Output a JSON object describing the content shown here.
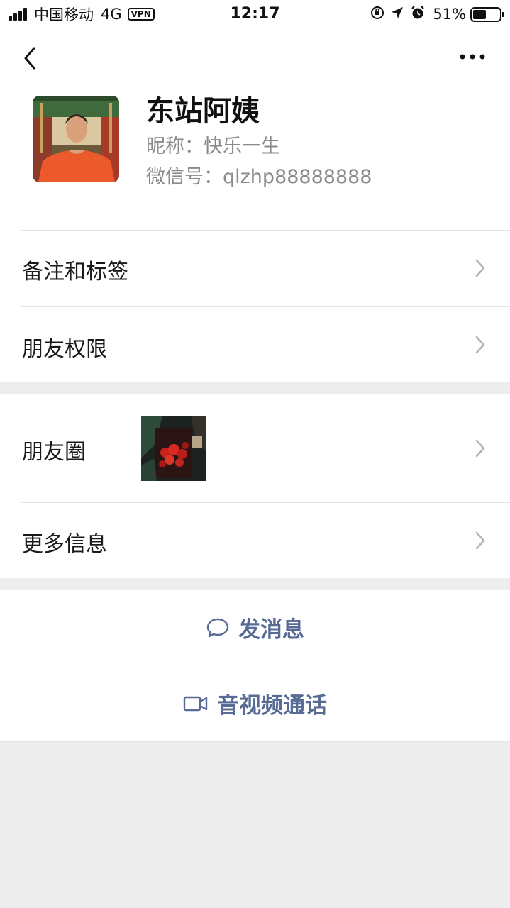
{
  "status_bar": {
    "carrier": "中国移动",
    "network": "4G",
    "vpn": "VPN",
    "time": "12:17",
    "battery_percent": "51%",
    "battery_level": 0.51,
    "icons": [
      "signal-icon",
      "orientation-lock-icon",
      "location-arrow-icon",
      "alarm-icon",
      "battery-icon"
    ]
  },
  "header": {
    "back_icon": "chevron-left-icon",
    "more_icon": "more-dots-icon"
  },
  "profile": {
    "name": "东站阿姨",
    "nickname": "昵称：快乐一生",
    "wechat_id": "微信号：qlzhp88888888"
  },
  "rows": {
    "remarks_tags": "备注和标签",
    "friend_permissions": "朋友权限",
    "moments": "朋友圈",
    "more_info": "更多信息"
  },
  "actions": {
    "send_message": "发消息",
    "av_call": "音视频通话"
  },
  "colors": {
    "accent": "#576b95",
    "background": "#ededed",
    "card": "#ffffff",
    "secondary_text": "#8a8a8a"
  }
}
